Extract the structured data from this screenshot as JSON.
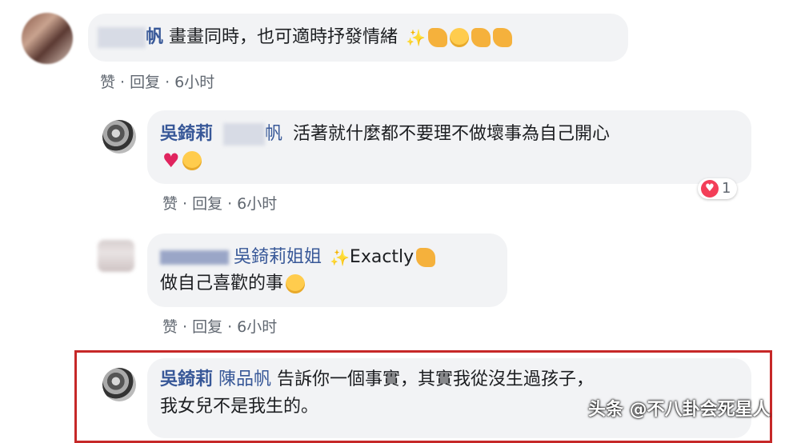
{
  "comments": [
    {
      "id": "c1",
      "author_suffix": "帆",
      "text": "畫畫同時，也可適時抒發情緒",
      "actions": {
        "like": "赞",
        "reply": "回复",
        "time": "6小时"
      }
    },
    {
      "id": "c2",
      "author": "吳錡莉",
      "mention_suffix": "帆",
      "text_line1": "活著就什麼都不要理不做壞事為自己開心",
      "reaction_count": "1",
      "actions": {
        "like": "赞",
        "reply": "回复",
        "time": "6小时"
      }
    },
    {
      "id": "c3",
      "mention": "吳錡莉姐姐",
      "text_en": "Exactly",
      "text_line2": "做自己喜歡的事",
      "actions": {
        "like": "赞",
        "reply": "回复",
        "time": "6小时"
      }
    },
    {
      "id": "c4",
      "author": "吳錡莉",
      "mention": "陳品帆",
      "text_line1": "告訴你一個事實，其實我從沒生過孩子，",
      "text_line2": "我女兒不是我生的。"
    }
  ],
  "watermark": "头条 @不八卦会死星人",
  "colors": {
    "link": "#385898",
    "highlight_border": "#c62828",
    "bubble": "#f2f3f5"
  }
}
